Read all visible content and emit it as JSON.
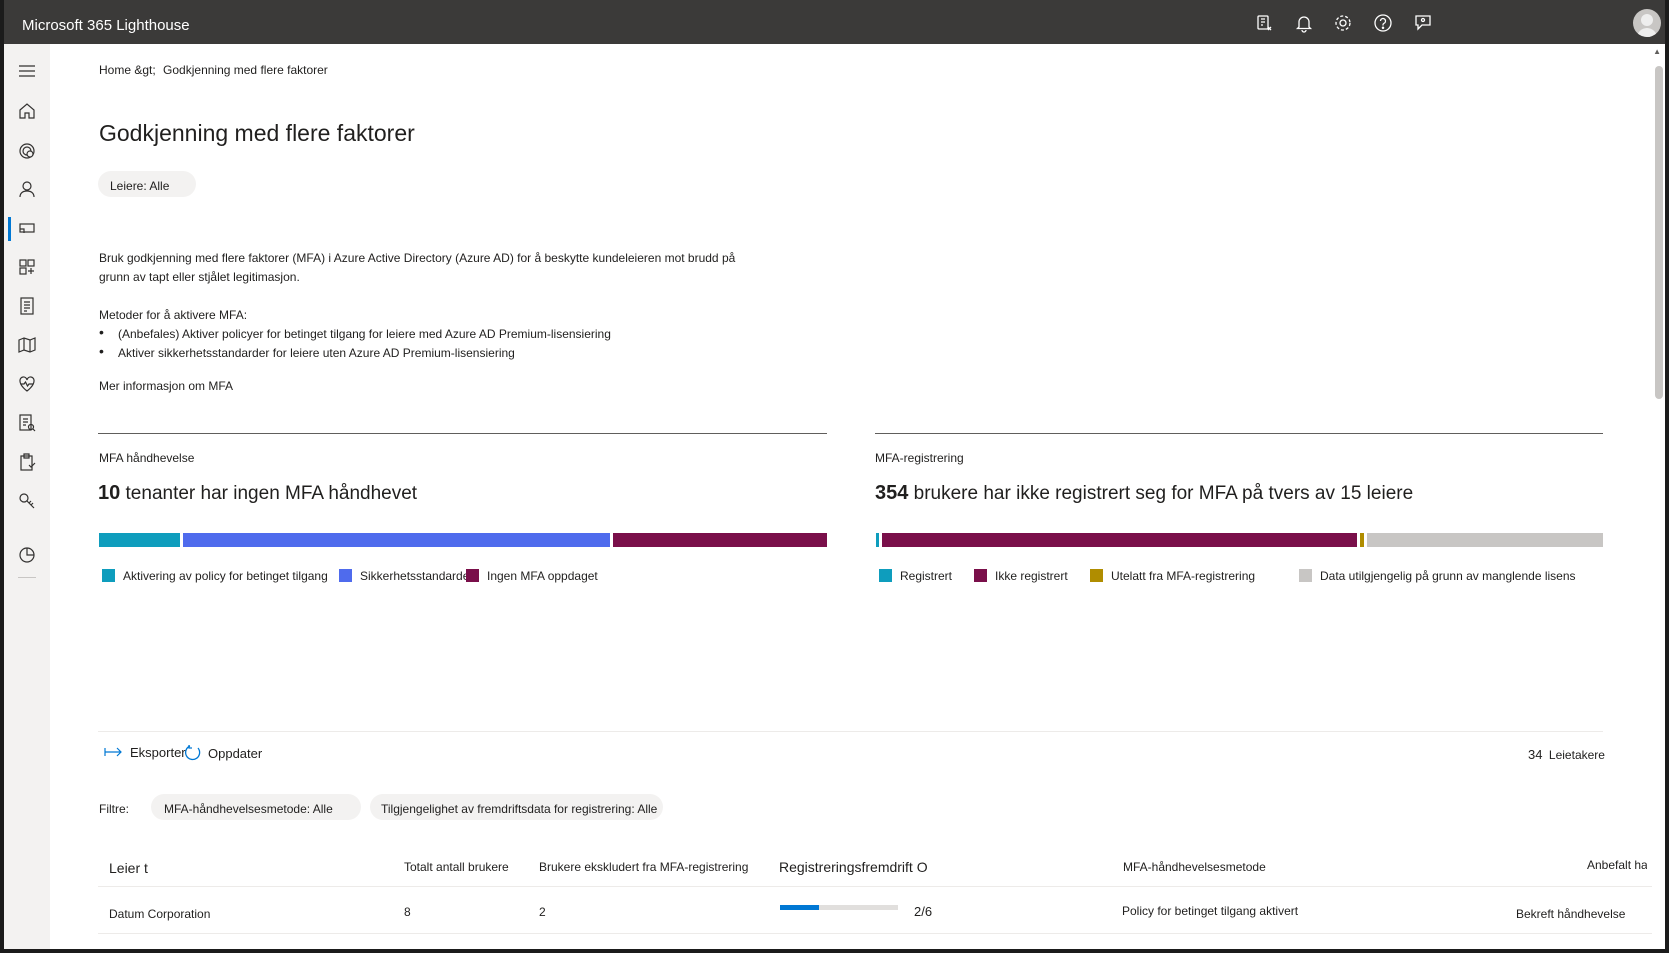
{
  "app": {
    "title": "Microsoft 365 Lighthouse"
  },
  "topbar_icons": [
    "tenant-switch-icon",
    "bell-icon",
    "gear-icon",
    "help-icon",
    "feedback-icon"
  ],
  "nav_icons": [
    "hamburger-icon",
    "home-icon",
    "tenants-icon",
    "users-icon",
    "devices-icon",
    "apps-icon",
    "reports-icon",
    "map-icon",
    "health-icon",
    "audit-icon",
    "tasks-icon",
    "key-icon",
    "usage-icon"
  ],
  "breadcrumb": {
    "home": "Home &gt;",
    "current": "Godkjenning med flere faktorer"
  },
  "page": {
    "title": "Godkjenning med flere faktorer",
    "tenant_filter": "Leiere: Alle",
    "description_1": "Bruk godkjenning med flere faktorer (MFA) i Azure Active Directory (Azure AD) for å beskytte kundeleieren mot brudd på",
    "description_2": "grunn av tapt eller stjålet legitimasjon.",
    "methods_title": "Metoder for å aktivere MFA:",
    "methods": [
      "(Anbefales) Aktiver policyer for betinget tilgang for leiere med Azure AD Premium-lisensiering",
      "Aktiver sikkerhetsstandarder for leiere uten Azure AD Premium-lisensiering"
    ],
    "more_info_link": "Mer informasjon om MFA"
  },
  "colors": {
    "conditional_access": "#0e9dbd",
    "security_defaults": "#4f6bed",
    "no_mfa": "#7a0f4a",
    "registered": "#0e9dbd",
    "not_registered": "#7a0f4a",
    "excluded": "#b08d00",
    "unavailable": "#c8c6c4",
    "accent": "#0078d4"
  },
  "enforcement_card": {
    "label": "MFA håndhevelse",
    "count": "10",
    "headline": "tenanter har ingen MFA håndhevet",
    "bar": [
      {
        "name": "Aktivering av policy for betinget tilgang",
        "share": 0.116,
        "color": "#0e9dbd"
      },
      {
        "name": "Sikkerhetsstandarder",
        "share": 0.59,
        "color": "#4f6bed"
      },
      {
        "name": "Ingen MFA oppdaget",
        "share": 0.294,
        "color": "#7a0f4a"
      }
    ],
    "legend": [
      "Aktivering av policy for betinget tilgang",
      "Sikkerhetsstandarder",
      "Ingen MFA oppdaget"
    ]
  },
  "registration_card": {
    "label": "MFA-registrering",
    "count": "354",
    "headline": "brukere har ikke registrert seg for MFA på tvers av 15 leiere",
    "bar": [
      {
        "name": "Registrert",
        "share": 0.008,
        "color": "#0e9dbd"
      },
      {
        "name": "Ikke registrert",
        "share": 0.658,
        "color": "#7a0f4a"
      },
      {
        "name": "Utelatt fra MFA-registrering",
        "share": 0.009,
        "color": "#b08d00"
      },
      {
        "name": "Data utilgjengelig på grunn av manglende lisens",
        "share": 0.325,
        "color": "#c8c6c4"
      }
    ],
    "legend": [
      "Registrert",
      "Ikke registrert",
      "Utelatt fra MFA-registrering",
      "Data utilgjengelig på grunn av manglende lisens"
    ]
  },
  "toolbar": {
    "export": "Eksporter",
    "refresh": "Oppdater",
    "count": "34",
    "count_label": "Leietakere"
  },
  "filters": {
    "label": "Filtre:",
    "enforcement_method": "MFA-håndhevelsesmetode: Alle",
    "data_availability": "Tilgjengelighet av fremdriftsdata for registrering: Alle"
  },
  "table": {
    "headers": {
      "tenant": "Leier t",
      "total_users": "Totalt antall brukere",
      "excluded": "Brukere ekskludert fra MFA-registrering",
      "progress": "Registreringsfremdrift O",
      "method": "MFA-håndhevelsesmetode",
      "action": "Anbefalt handling"
    },
    "rows": [
      {
        "tenant": "Datum Corporation",
        "total_users": "8",
        "excluded": "2",
        "progress_fraction": 0.333,
        "progress_text": "2/6",
        "method": "Policy for betinget tilgang aktivert",
        "action": "Bekreft håndhevelse"
      }
    ]
  }
}
